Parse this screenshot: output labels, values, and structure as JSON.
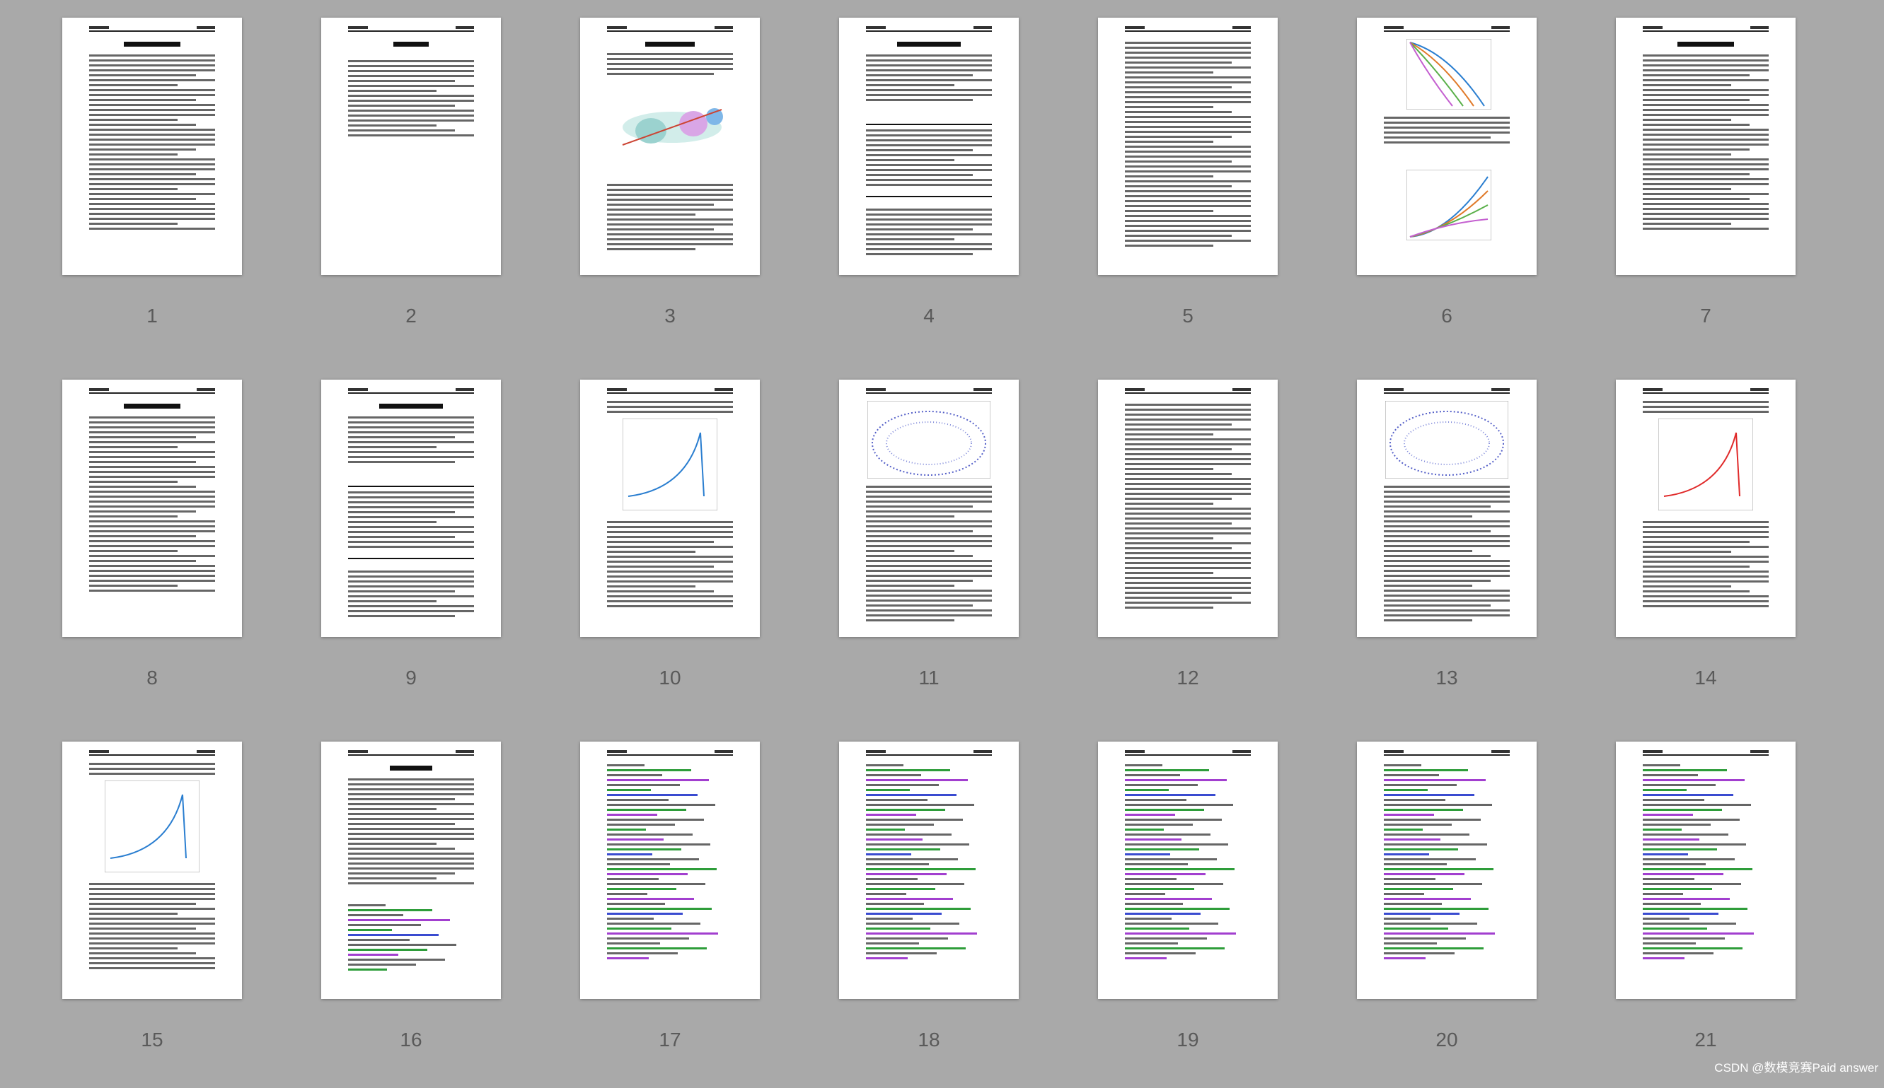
{
  "pages": [
    {
      "number": "1",
      "kind": "text"
    },
    {
      "number": "2",
      "kind": "toc"
    },
    {
      "number": "3",
      "kind": "figure-top"
    },
    {
      "number": "4",
      "kind": "table"
    },
    {
      "number": "5",
      "kind": "equations"
    },
    {
      "number": "6",
      "kind": "two-charts"
    },
    {
      "number": "7",
      "kind": "text"
    },
    {
      "number": "8",
      "kind": "text"
    },
    {
      "number": "9",
      "kind": "table"
    },
    {
      "number": "10",
      "kind": "chart"
    },
    {
      "number": "11",
      "kind": "scatter"
    },
    {
      "number": "12",
      "kind": "equations"
    },
    {
      "number": "13",
      "kind": "scatter"
    },
    {
      "number": "14",
      "kind": "chart"
    },
    {
      "number": "15",
      "kind": "chart"
    },
    {
      "number": "16",
      "kind": "refs"
    },
    {
      "number": "17",
      "kind": "code"
    },
    {
      "number": "18",
      "kind": "code"
    },
    {
      "number": "19",
      "kind": "code"
    },
    {
      "number": "20",
      "kind": "code"
    },
    {
      "number": "21",
      "kind": "code"
    }
  ],
  "watermark": "CSDN @数模竞赛Paid answer"
}
